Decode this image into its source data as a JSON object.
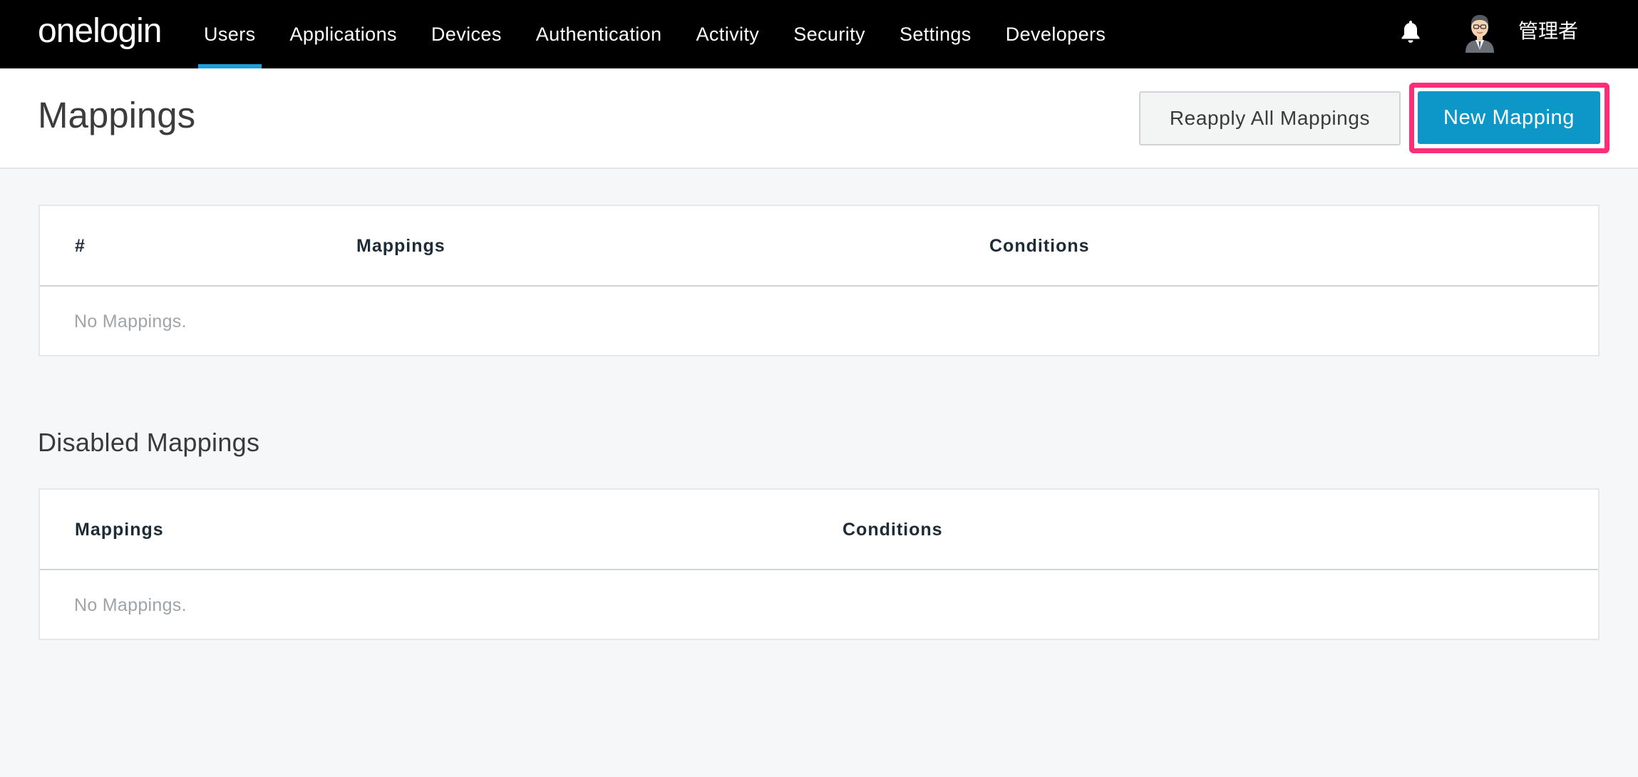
{
  "nav": {
    "logo": "onelogin",
    "items": [
      {
        "label": "Users",
        "active": true
      },
      {
        "label": "Applications",
        "active": false
      },
      {
        "label": "Devices",
        "active": false
      },
      {
        "label": "Authentication",
        "active": false
      },
      {
        "label": "Activity",
        "active": false
      },
      {
        "label": "Security",
        "active": false
      },
      {
        "label": "Settings",
        "active": false
      },
      {
        "label": "Developers",
        "active": false
      }
    ],
    "user_name": "管理者",
    "icons": {
      "notifications": "bell-icon",
      "profile": "avatar"
    }
  },
  "header": {
    "title": "Mappings",
    "reapply_label": "Reapply All Mappings",
    "new_label": "New Mapping"
  },
  "mappings_table": {
    "columns": [
      "#",
      "Mappings",
      "Conditions"
    ],
    "empty_text": "No Mappings."
  },
  "disabled_section": {
    "title": "Disabled Mappings",
    "columns": [
      "Mappings",
      "Conditions"
    ],
    "empty_text": "No Mappings."
  },
  "colors": {
    "nav_bg": "#000000",
    "accent": "#0d97c8",
    "active_tab_underline": "#1ca0d8",
    "highlight": "#ff2d78"
  }
}
